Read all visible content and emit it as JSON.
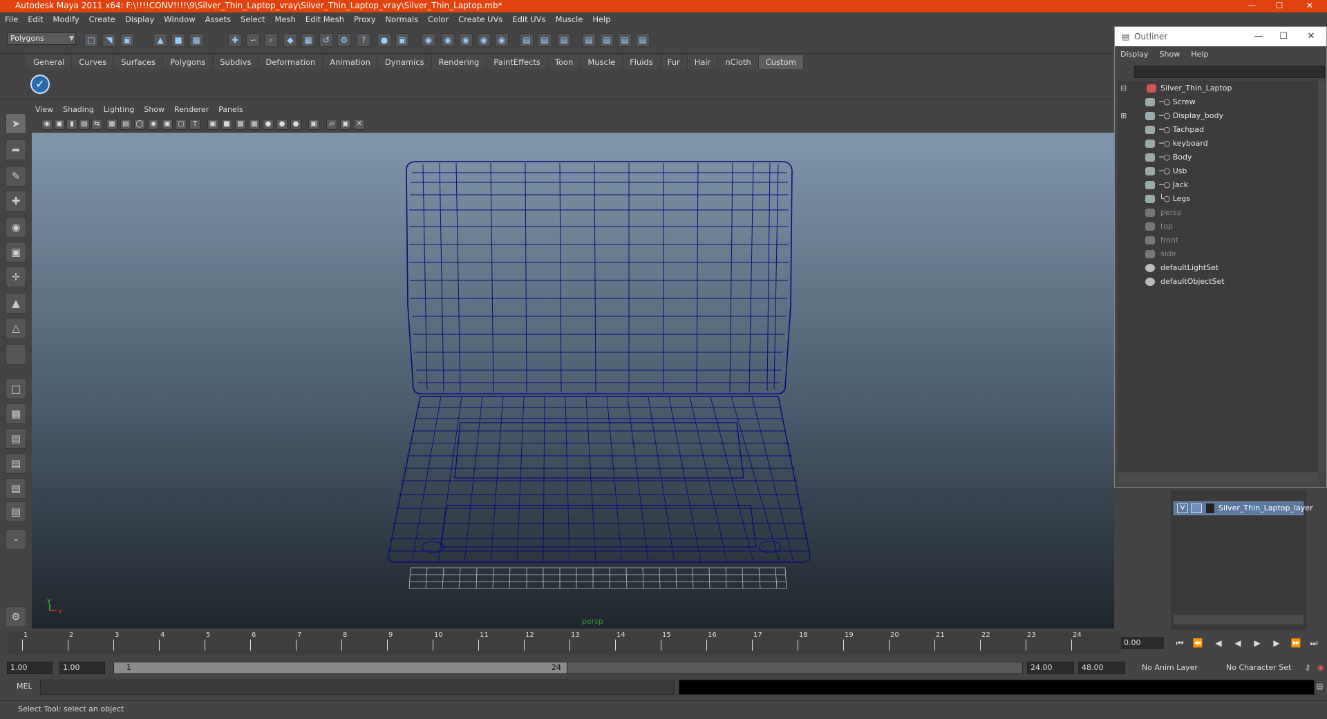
{
  "window": {
    "title": "Autodesk Maya 2011 x64: F:\\!!!!CONV!!!!\\9\\Silver_Thin_Laptop_vray\\Silver_Thin_Laptop_vray\\Silver_Thin_Laptop.mb*",
    "title_bar_color": "#e0430f"
  },
  "menubar": {
    "items": [
      "File",
      "Edit",
      "Modify",
      "Create",
      "Display",
      "Window",
      "Assets",
      "Select",
      "Mesh",
      "Edit Mesh",
      "Proxy",
      "Normals",
      "Color",
      "Create UVs",
      "Edit UVs",
      "Muscle",
      "Help"
    ]
  },
  "statusline": {
    "mode": "Polygons"
  },
  "shelf": {
    "tabs": [
      "General",
      "Curves",
      "Surfaces",
      "Polygons",
      "Subdivs",
      "Deformation",
      "Animation",
      "Dynamics",
      "Rendering",
      "PaintEffects",
      "Toon",
      "Muscle",
      "Fluids",
      "Fur",
      "Hair",
      "nCloth",
      "Custom"
    ],
    "active_tab": "Custom"
  },
  "viewport": {
    "menu": [
      "View",
      "Shading",
      "Lighting",
      "Show",
      "Renderer",
      "Panels"
    ],
    "camera_label": "persp",
    "axis_x": "x",
    "axis_y": "y",
    "wire_color": "#0b0b7a"
  },
  "timeline": {
    "ticks": [
      "1",
      "2",
      "3",
      "4",
      "5",
      "6",
      "7",
      "8",
      "9",
      "10",
      "11",
      "12",
      "13",
      "14",
      "15",
      "16",
      "17",
      "18",
      "19",
      "20",
      "21",
      "22",
      "23",
      "24"
    ],
    "current_frame": "0.00"
  },
  "range": {
    "start_time": "1.00",
    "start_range": "1.00",
    "slider_start": "1",
    "slider_end": "24",
    "end_range": "24.00",
    "end_time": "48.00",
    "anim_layer": "No Anim Layer",
    "character_set": "No Character Set"
  },
  "cmdline": {
    "label": "MEL"
  },
  "helpline": {
    "text": "Select Tool: select an object"
  },
  "outliner": {
    "title": "Outliner",
    "menu": [
      "Display",
      "Show",
      "Help"
    ],
    "items": [
      {
        "label": "Silver_Thin_Laptop",
        "dim": false
      },
      {
        "label": "Screw",
        "dim": false
      },
      {
        "label": "Display_body",
        "dim": false
      },
      {
        "label": "Tachpad",
        "dim": false
      },
      {
        "label": "keyboard",
        "dim": false
      },
      {
        "label": "Body",
        "dim": false
      },
      {
        "label": "Usb",
        "dim": false
      },
      {
        "label": "Jack",
        "dim": false
      },
      {
        "label": "Legs",
        "dim": false
      },
      {
        "label": "persp",
        "dim": true
      },
      {
        "label": "top",
        "dim": true
      },
      {
        "label": "front",
        "dim": true
      },
      {
        "label": "side",
        "dim": true
      },
      {
        "label": "defaultLightSet",
        "dim": false
      },
      {
        "label": "defaultObjectSet",
        "dim": false
      }
    ]
  },
  "layers": {
    "visible_flag": "V",
    "name": "Silver_Thin_Laptop_layer"
  }
}
